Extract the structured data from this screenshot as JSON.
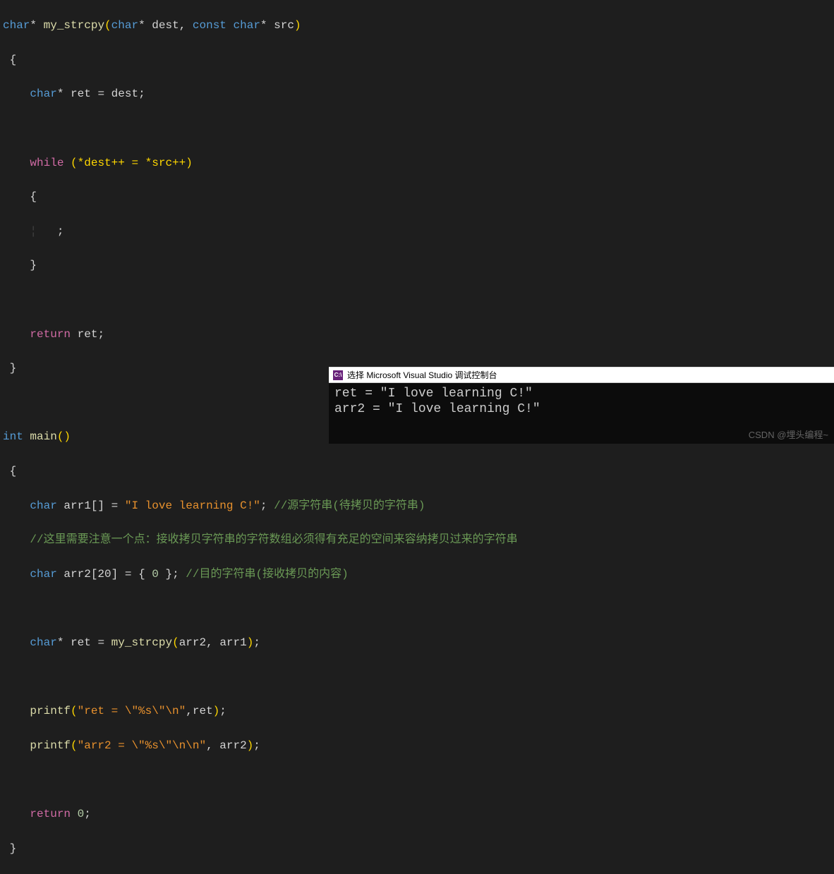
{
  "code": {
    "fn_sig_type": "char",
    "ptr": "*",
    "fn_name": "my_strcpy",
    "param1_type": "char",
    "param1_name": "dest",
    "const": "const",
    "param2_type": "char",
    "param2_name": "src",
    "ret_decl_type": "char",
    "ret_var": "ret",
    "eq": "=",
    "dest_ref": "dest",
    "while_kw": "while",
    "cond": "(*dest++ = *src++)",
    "semicolon": ";",
    "return_kw": "return",
    "int_type": "int",
    "main_name": "main",
    "arr1_type": "char",
    "arr1_name": "arr1",
    "arr1_brackets": "[]",
    "arr1_value": "\"I love learning C!\"",
    "comment1": "//源字符串(待拷贝的字符串)",
    "comment2": "//这里需要注意一个点：接收拷贝字符串的字符数组必须得有充足的空间来容纳拷贝过来的字符串",
    "arr2_type": "char",
    "arr2_name": "arr2",
    "arr2_brackets": "[20]",
    "zero": "0",
    "comment3": "//目的字符串(接收拷贝的内容)",
    "strcpy_call": "my_strcpy",
    "arr2_arg": "arr2",
    "arr1_arg": "arr1",
    "printf_name": "printf",
    "printf1_str": "\"ret = \\\"%s\\\"\\n\"",
    "printf1_arg": "ret",
    "printf2_str": "\"arr2 = \\\"%s\\\"\\n\\n\"",
    "printf2_arg": "arr2",
    "return_zero": "0"
  },
  "console": {
    "icon_text": "C:\\",
    "title": "选择 Microsoft Visual Studio 调试控制台",
    "line1": "ret = \"I love learning C!\"",
    "line2": "arr2 = \"I love learning C!\""
  },
  "watermark": "CSDN @埋头编程~"
}
